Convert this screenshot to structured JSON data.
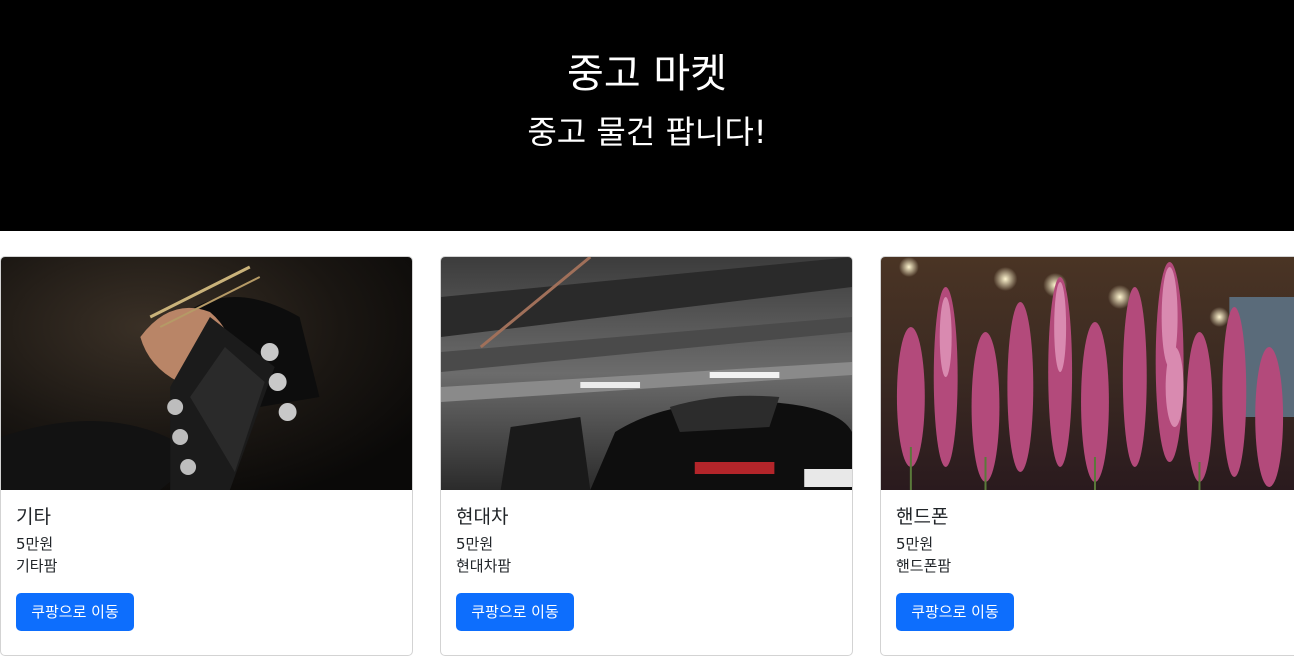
{
  "hero": {
    "title": "중고 마켓",
    "subtitle": "중고 물건 팝니다!"
  },
  "cards": [
    {
      "image": "guitar-photo",
      "title": "기타",
      "price": "5만원",
      "description": "기타팜",
      "button_label": "쿠팡으로 이동"
    },
    {
      "image": "car-photo",
      "title": "현대차",
      "price": "5만원",
      "description": "현대차팜",
      "button_label": "쿠팡으로 이동"
    },
    {
      "image": "flowers-photo",
      "title": "핸드폰",
      "price": "5만원",
      "description": "핸드폰팜",
      "button_label": "쿠팡으로 이동"
    }
  ],
  "colors": {
    "hero_bg": "#000000",
    "button_bg": "#0d6efd",
    "text": "#212529"
  }
}
